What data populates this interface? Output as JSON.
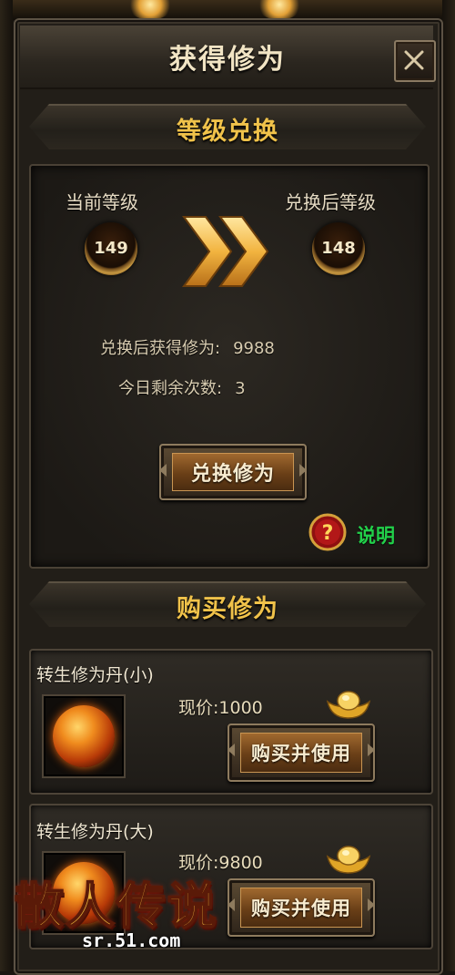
{
  "dialog": {
    "title": "获得修为",
    "close_icon": "close-x-icon"
  },
  "level_exchange": {
    "header": "等级兑换",
    "current_level_label": "当前等级",
    "current_level": "149",
    "after_level_label": "兑换后等级",
    "after_level": "148",
    "gain_label": "兑换后获得修为:",
    "gain_value": "9988",
    "remaining_label": "今日剩余次数:",
    "remaining_value": "3",
    "exchange_button": "兑换修为",
    "help_label": "说明"
  },
  "buy_section": {
    "header": "购买修为",
    "items": [
      {
        "name": "转生修为丹(小)",
        "price": "现价:1000",
        "button": "购买并使用"
      },
      {
        "name": "转生修为丹(大)",
        "price": "现价:9800",
        "button": "购买并使用"
      }
    ]
  },
  "watermark": {
    "logo_text": "散人传说",
    "url": "sr.51.com"
  },
  "colors": {
    "accent_gold": "#f0c24a",
    "help_green": "#22d04a"
  }
}
